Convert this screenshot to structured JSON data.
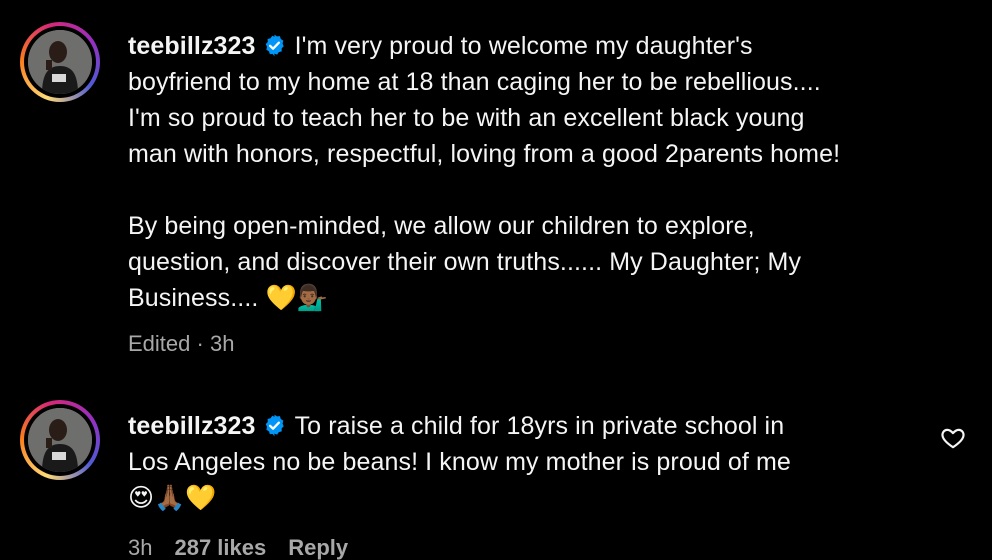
{
  "comments": [
    {
      "username": "teebillz323",
      "text": "I'm very proud to welcome my daughter's\nboyfriend to my home at 18 than caging her to be rebellious....\nI'm so proud to teach her to be with an excellent black young\nman with honors, respectful, loving from a good 2parents home!\n\nBy being open-minded, we allow our children to explore,\nquestion, and discover their own truths...... My Daughter; My\nBusiness.... ",
      "emoji": "💛💁🏾‍♂️",
      "edited": "Edited",
      "separator": "·",
      "time": "3h"
    },
    {
      "username": "teebillz323",
      "text": "To raise a child for 18yrs in private school in\nLos Angeles no be beans! I know my mother is proud of me\n",
      "emoji": "😍🙏🏾💛",
      "time": "3h",
      "likes": "287 likes",
      "reply": "Reply"
    }
  ],
  "colors": {
    "background": "#000000",
    "text": "#f5f5f5",
    "muted": "#a8a8a8",
    "verified": "#0095f6"
  },
  "icons": {
    "verified": "verified-badge-icon",
    "like": "heart-outline-icon"
  }
}
